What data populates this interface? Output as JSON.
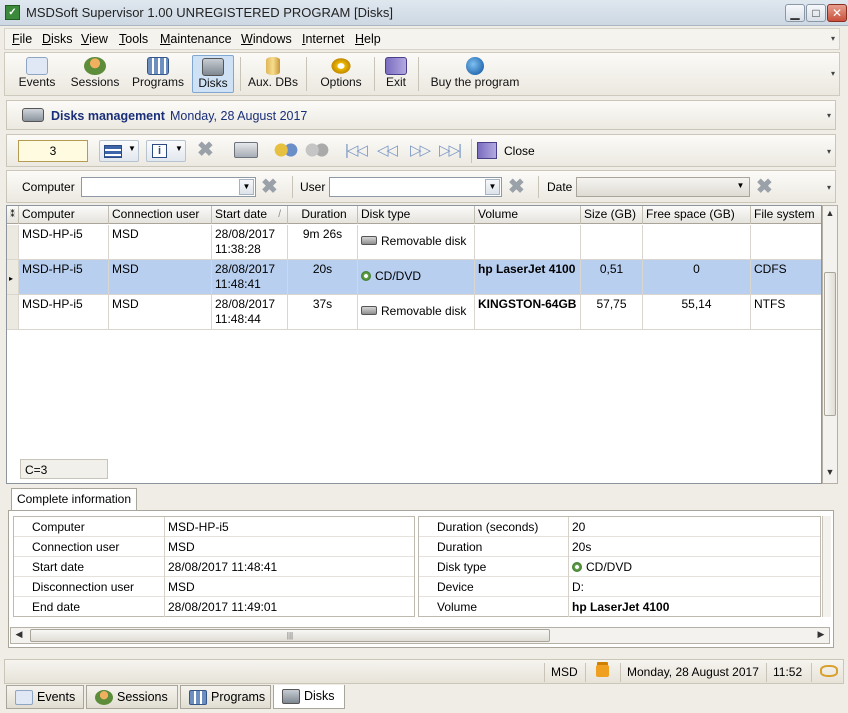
{
  "window": {
    "title": "MSDSoft Supervisor 1.00 UNREGISTERED PROGRAM [Disks]",
    "app_icon": "msd-icon"
  },
  "menu": [
    {
      "label": "File",
      "u": "F",
      "rest": "ile"
    },
    {
      "label": "Disks",
      "u": "D",
      "rest": "isks"
    },
    {
      "label": "View",
      "u": "V",
      "rest": "iew"
    },
    {
      "label": "Tools",
      "u": "T",
      "rest": "ools"
    },
    {
      "label": "Maintenance",
      "u": "M",
      "rest": "aintenance"
    },
    {
      "label": "Windows",
      "u": "W",
      "rest": "indows"
    },
    {
      "label": "Internet",
      "u": "I",
      "rest": "nternet"
    },
    {
      "label": "Help",
      "u": "H",
      "rest": "elp"
    }
  ],
  "toolbar": {
    "events": "Events",
    "sessions": "Sessions",
    "programs": "Programs",
    "disks": "Disks",
    "auxdbs": "Aux. DBs",
    "options": "Options",
    "exit": "Exit",
    "buy": "Buy the program"
  },
  "panel": {
    "title": "Disks management",
    "date": "Monday, 28 August 2017"
  },
  "nav": {
    "count": "3",
    "close": "Close"
  },
  "filters": {
    "computer_label": "Computer",
    "user_label": "User",
    "date_label": "Date",
    "computer_value": "",
    "user_value": ""
  },
  "grid": {
    "headers": [
      "Computer",
      "Connection user",
      "Start date",
      "Duration",
      "Disk type",
      "Volume",
      "Size (GB)",
      "Free space (GB)",
      "File system"
    ],
    "sort_indicator": "/",
    "rows": [
      {
        "computer": "MSD-HP-i5",
        "user": "MSD",
        "date": "28/08/2017",
        "time": "11:38:28",
        "duration": "9m 26s",
        "disk_type": "Removable disk",
        "disk_icon": "removable-disk-icon",
        "volume": "",
        "size": "",
        "free": "",
        "fs": ""
      },
      {
        "computer": "MSD-HP-i5",
        "user": "MSD",
        "date": "28/08/2017",
        "time": "11:48:41",
        "duration": "20s",
        "disk_type": "CD/DVD",
        "disk_icon": "cd-dvd-icon",
        "volume": "hp LaserJet 4100",
        "size": "0,51",
        "free": "0",
        "fs": "CDFS"
      },
      {
        "computer": "MSD-HP-i5",
        "user": "MSD",
        "date": "28/08/2017",
        "time": "11:48:44",
        "duration": "37s",
        "disk_type": "Removable disk",
        "disk_icon": "removable-disk-icon",
        "volume": "KINGSTON-64GB",
        "size": "57,75",
        "free": "55,14",
        "fs": "NTFS"
      }
    ],
    "footer": "C=3"
  },
  "details": {
    "tab": "Complete information",
    "left": [
      {
        "k": "Computer",
        "v": "MSD-HP-i5"
      },
      {
        "k": "Connection user",
        "v": "MSD"
      },
      {
        "k": "Start date",
        "v": "28/08/2017 11:48:41"
      },
      {
        "k": "Disconnection user",
        "v": "MSD"
      },
      {
        "k": "End date",
        "v": "28/08/2017 11:49:01"
      }
    ],
    "right": [
      {
        "k": "Duration (seconds)",
        "v": "20"
      },
      {
        "k": "Duration",
        "v": "20s"
      },
      {
        "k": "Disk type",
        "v": "CD/DVD"
      },
      {
        "k": "Device",
        "v": "D:"
      },
      {
        "k": "Volume",
        "v": "hp LaserJet 4100"
      }
    ]
  },
  "status": {
    "user": "MSD",
    "date": "Monday, 28 August 2017",
    "time": "11:52"
  },
  "bottom_tabs": [
    "Events",
    "Sessions",
    "Programs",
    "Disks"
  ]
}
